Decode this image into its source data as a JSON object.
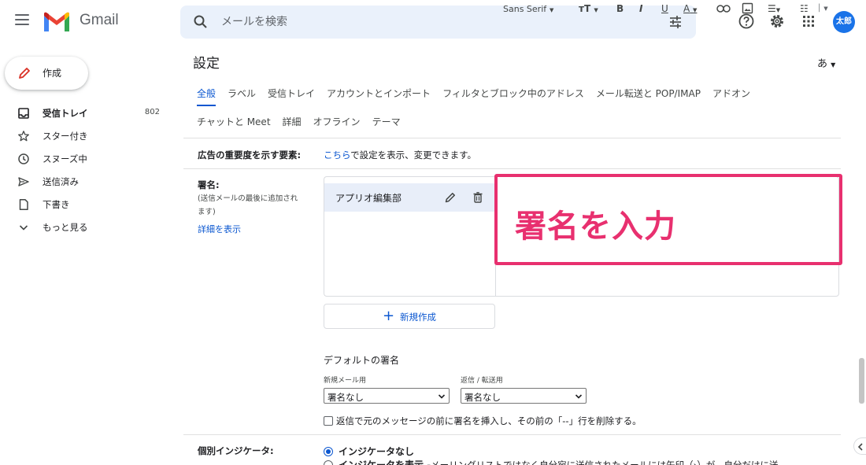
{
  "app": {
    "name": "Gmail"
  },
  "search": {
    "placeholder": "メールを検索"
  },
  "user": {
    "avatar_text": "太郎"
  },
  "compose": {
    "label": "作成"
  },
  "sidebar": {
    "items": [
      {
        "label": "受信トレイ",
        "count": "802",
        "icon": "inbox-icon"
      },
      {
        "label": "スター付き",
        "count": "",
        "icon": "star-icon"
      },
      {
        "label": "スヌーズ中",
        "count": "",
        "icon": "clock-icon"
      },
      {
        "label": "送信済み",
        "count": "",
        "icon": "send-icon"
      },
      {
        "label": "下書き",
        "count": "",
        "icon": "draft-icon"
      },
      {
        "label": "もっと見る",
        "count": "",
        "icon": "chevron-down-icon"
      }
    ]
  },
  "settings": {
    "title": "設定",
    "lang_toggle": "あ",
    "tabs_row1": [
      "全般",
      "ラベル",
      "受信トレイ",
      "アカウントとインポート",
      "フィルタとブロック中のアドレス",
      "メール転送と POP/IMAP",
      "アドオン"
    ],
    "tabs_row2": [
      "チャットと Meet",
      "詳細",
      "オフライン",
      "テーマ"
    ],
    "ads": {
      "label": "広告の重要度を示す要素:",
      "link": "こちら",
      "text": "で設定を表示、変更できます。"
    },
    "signature": {
      "label": "署名:",
      "sub1": "(送信メールの最後に追加され",
      "sub2": "ます)",
      "details_link": "詳細を表示",
      "entry_name": "アプリオ編集部",
      "annotation": "署名を入力",
      "toolbar_font": "Sans Serif",
      "new_button": "新規作成"
    },
    "default_signature": {
      "title": "デフォルトの署名",
      "new_mail_label": "新規メール用",
      "reply_label": "返信 / 転送用",
      "new_mail_value": "署名なし",
      "reply_value": "署名なし",
      "checkbox_text": "返信で元のメッセージの前に署名を挿入し、その前の「--」行を削除する。"
    },
    "indicator": {
      "label": "個別インジケータ:",
      "opt1": "インジケータなし",
      "opt2_title": "インジケータを表示 -",
      "opt2_desc": " メーリングリストではなく自分宛に送信されたメールには矢印（›）が、自分だけに送"
    }
  },
  "colors": {
    "accent": "#0b57d0",
    "annotation": "#e8306f"
  }
}
